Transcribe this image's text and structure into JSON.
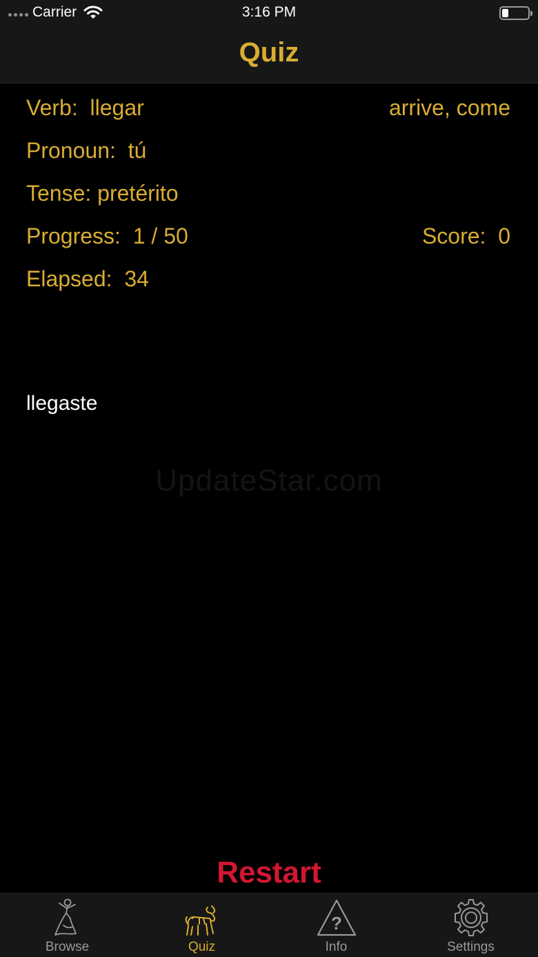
{
  "status_bar": {
    "carrier": "Carrier",
    "time": "3:16 PM",
    "battery_level": 0.25
  },
  "nav": {
    "title": "Quiz"
  },
  "quiz": {
    "verb_label": "Verb:",
    "verb": "llegar",
    "translation": "arrive, come",
    "pronoun_label": "Pronoun:",
    "pronoun": "tú",
    "tense_label": "Tense:",
    "tense": "pretérito",
    "progress_label": "Progress:",
    "progress": "1 / 50",
    "score_label": "Score:",
    "score": "0",
    "elapsed_label": "Elapsed:",
    "elapsed": "34",
    "answer": "llegaste"
  },
  "watermark": "UpdateStar.com",
  "restart_label": "Restart",
  "tabs": [
    {
      "label": "Browse",
      "icon": "dancer-icon",
      "active": false
    },
    {
      "label": "Quiz",
      "icon": "bull-icon",
      "active": true
    },
    {
      "label": "Info",
      "icon": "warning-question-icon",
      "active": false
    },
    {
      "label": "Settings",
      "icon": "gear-icon",
      "active": false
    }
  ],
  "colors": {
    "accent": "#d9ad32",
    "restart": "#d21732",
    "inactive": "#9a9a9a"
  }
}
